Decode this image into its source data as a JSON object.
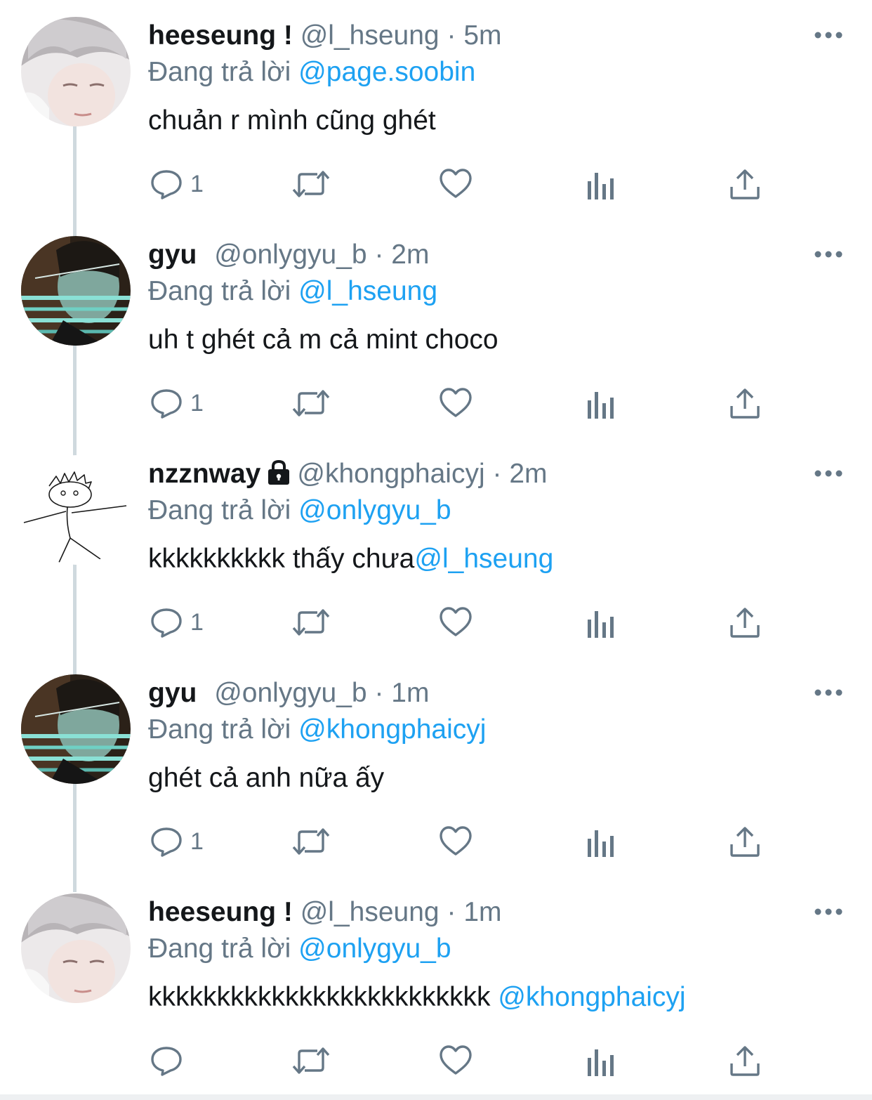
{
  "tweets": [
    {
      "name": "heeseung !",
      "handle": "@l_hseung",
      "separator": "·",
      "time": "5m",
      "replying_prefix": "Đang trả lời",
      "replying_to": "@page.soobin",
      "text": "chuản r mình cũng ghét",
      "mention_in_text": "",
      "reply_count": "1",
      "avatar": "heeseung-avatar",
      "locked": false
    },
    {
      "name": "gyu",
      "handle": "@onlygyu_b",
      "separator": "·",
      "time": "2m",
      "replying_prefix": "Đang trả lời",
      "replying_to": "@l_hseung",
      "text": "uh t ghét cả m cả mint choco",
      "mention_in_text": "",
      "reply_count": "1",
      "avatar": "gyu-avatar",
      "locked": false
    },
    {
      "name": "nzznway",
      "handle": "@khongphaicyj",
      "separator": "·",
      "time": "2m",
      "replying_prefix": "Đang trả lời",
      "replying_to": "@onlygyu_b",
      "text": "kkkkkkkkkk thấy chưa",
      "mention_in_text": "@l_hseung",
      "reply_count": "1",
      "avatar": "doodle-avatar",
      "locked": true
    },
    {
      "name": "gyu",
      "handle": "@onlygyu_b",
      "separator": "·",
      "time": "1m",
      "replying_prefix": "Đang trả lời",
      "replying_to": "@khongphaicyj",
      "text": "ghét cả anh nữa ấy",
      "mention_in_text": "",
      "reply_count": "1",
      "avatar": "gyu-avatar",
      "locked": false
    },
    {
      "name": "heeseung !",
      "handle": "@l_hseung",
      "separator": "·",
      "time": "1m",
      "replying_prefix": "Đang trả lời",
      "replying_to": "@onlygyu_b",
      "text": "kkkkkkkkkkkkkkkkkkkkkkkkk ",
      "mention_in_text": "@khongphaicyj",
      "reply_count": "",
      "avatar": "heeseung-avatar",
      "locked": false
    }
  ],
  "icons": {
    "reply": "reply-icon",
    "retweet": "retweet-icon",
    "like": "like-icon",
    "analytics": "analytics-icon",
    "share": "share-icon",
    "more": "more-icon",
    "lock": "lock-icon"
  },
  "colors": {
    "text": "#14171a",
    "secondary": "#657786",
    "link": "#1da1f2",
    "thread_line": "#cfd9de"
  }
}
